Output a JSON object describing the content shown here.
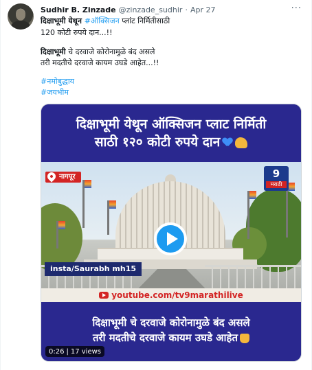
{
  "tweet": {
    "author_name": "Sudhir B. Zinzade",
    "handle": "@zinzade_sudhir",
    "separator": "·",
    "date": "Apr 27",
    "more_label": "···",
    "line1_prefix": "दिक्षाभूमी येथून ",
    "line1_tag": "#ऑक्सिजन",
    "line1_suffix": " प्लांट निर्मितीसाठी",
    "line2": "120 कोटी रुपये दान...!!",
    "line3_bold": "दिक्षाभूमी",
    "line3_rest": " चे दरवाजे कोरोनामुळे बंद असले",
    "line4": "तरी मदतीचे दरवाजे कायम उघडे आहेत...!!",
    "hashtag1": "#नमोबुद्धाय",
    "hashtag2": "#जयभीम"
  },
  "video": {
    "headline_line1": "दिक्षाभूमी येथून ऑक्सिजन प्लाट निर्मिती",
    "headline_line2": "साठी १२० कोटी रुपये दान",
    "location": "नागपूर",
    "channel_logo": "9",
    "channel_sub": "मराठी",
    "credit": "insta/Saurabh mh15",
    "youtube_url": "youtube.com/tv9marathilive",
    "bottom_line1": "दिक्षाभूमी चे दरवाजे कोरोनामुळे बंद असले",
    "bottom_line2": "तरी मदतीचे दरवाजे कायम उघडे आहेत",
    "duration": "0:26",
    "views": "17 views",
    "icons": [
      "blue-heart-icon",
      "flexed-biceps-icon",
      "praying-hands-icon",
      "location-pin-icon",
      "youtube-icon",
      "play-icon"
    ]
  },
  "colors": {
    "accent": "#1d9bf0",
    "banner_bg": "#2a288f",
    "news_red": "#d32424",
    "text_primary": "#0f1419",
    "text_secondary": "#536471"
  }
}
